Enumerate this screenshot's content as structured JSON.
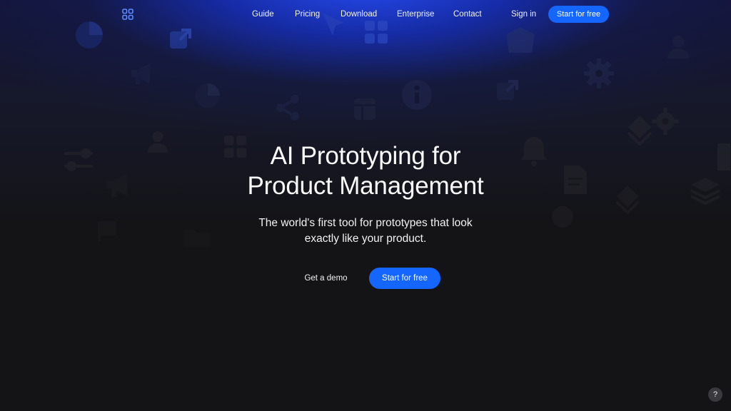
{
  "brand": {
    "logo_icon": "four-dots-logo-icon",
    "accent_color": "#1565ff"
  },
  "nav": {
    "links": [
      "Guide",
      "Pricing",
      "Download",
      "Enterprise",
      "Contact"
    ],
    "sign_in": "Sign in",
    "cta": "Start for free"
  },
  "hero": {
    "title_line1": "AI Prototyping for",
    "title_line2": "Product Management",
    "subtitle_line1": "The world's first tool for prototypes that look",
    "subtitle_line2": "exactly like your product.",
    "secondary_button": "Get a demo",
    "primary_button": "Start for free"
  },
  "help_button": "?",
  "background_icons": [
    "pie-chart-icon",
    "external-link-icon",
    "megaphone-icon",
    "share-icon",
    "grid-icon",
    "info-icon",
    "gear-icon",
    "user-icon",
    "bell-icon",
    "document-icon",
    "layers-icon",
    "diamond-icon",
    "slider-icon"
  ]
}
